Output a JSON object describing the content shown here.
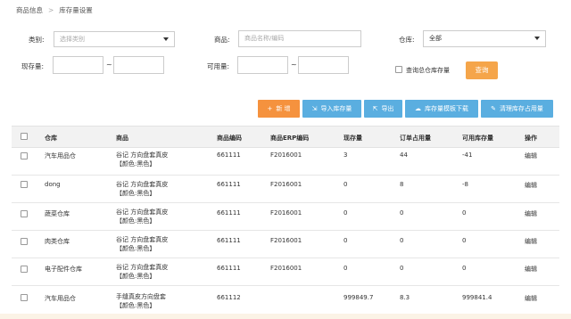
{
  "breadcrumb": {
    "parent": "商品信息",
    "separator": ">",
    "current": "库存量设置"
  },
  "filters": {
    "category_label": "类别:",
    "category_placeholder": "选择类别",
    "product_label": "商品:",
    "product_placeholder": "商品名称/编码",
    "warehouse_label": "仓库:",
    "warehouse_value": "全部",
    "stock_label": "现存量:",
    "available_label": "可用量:",
    "range_sep": "~",
    "total_stock_checkbox": "查询总仓库存量",
    "query_button": "查询"
  },
  "toolbar": {
    "add": "新 增",
    "import": "导入库存量",
    "export": "导出",
    "template": "库存量模板下载",
    "clear": "清理库存占用量"
  },
  "table": {
    "headers": [
      "仓库",
      "商品",
      "商品编码",
      "商品ERP编码",
      "现存量",
      "订单占用量",
      "可用库存量",
      "操作"
    ],
    "rows": [
      {
        "warehouse": "汽车用品仓",
        "product": "谷记 方向盘套真皮",
        "attr": "【颜色:黑色】",
        "code": "661111",
        "erp": "F2016001",
        "stock": "3",
        "occupied": "44",
        "available": "-41",
        "action": "编辑"
      },
      {
        "warehouse": "dong",
        "product": "谷记 方向盘套真皮",
        "attr": "【颜色:黑色】",
        "code": "661111",
        "erp": "F2016001",
        "stock": "0",
        "occupied": "8",
        "available": "-8",
        "action": "编辑"
      },
      {
        "warehouse": "蔬菜仓库",
        "product": "谷记 方向盘套真皮",
        "attr": "【颜色:黑色】",
        "code": "661111",
        "erp": "F2016001",
        "stock": "0",
        "occupied": "0",
        "available": "0",
        "action": "编辑"
      },
      {
        "warehouse": "肉类仓库",
        "product": "谷记 方向盘套真皮",
        "attr": "【颜色:黑色】",
        "code": "661111",
        "erp": "F2016001",
        "stock": "0",
        "occupied": "0",
        "available": "0",
        "action": "编辑"
      },
      {
        "warehouse": "电子配件仓库",
        "product": "谷记 方向盘套真皮",
        "attr": "【颜色:黑色】",
        "code": "661111",
        "erp": "F2016001",
        "stock": "0",
        "occupied": "0",
        "available": "0",
        "action": "编辑"
      },
      {
        "warehouse": "汽车用品仓",
        "product": "手缝真皮方向盘套",
        "attr": "【颜色:黑色】",
        "code": "661112",
        "erp": "",
        "stock": "999849.7",
        "occupied": "8.3",
        "available": "999841.4",
        "action": "编辑"
      }
    ]
  }
}
